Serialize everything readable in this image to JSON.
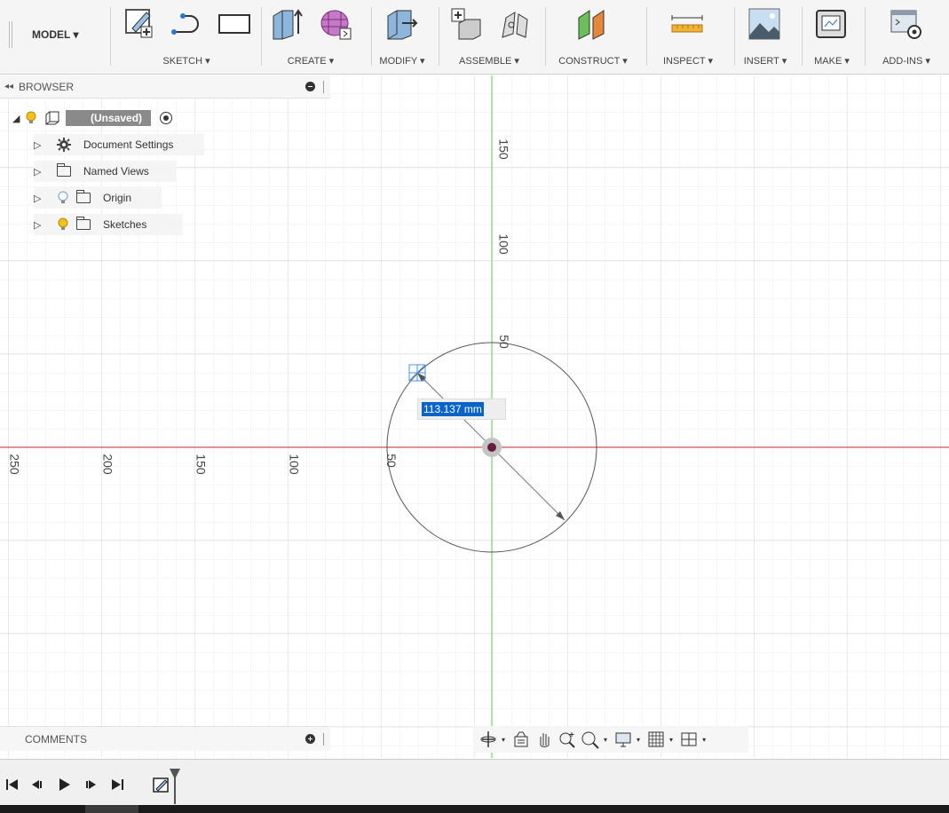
{
  "toolbar": {
    "workspace": "MODEL",
    "groups": [
      {
        "label": "SKETCH"
      },
      {
        "label": "CREATE"
      },
      {
        "label": "MODIFY"
      },
      {
        "label": "ASSEMBLE"
      },
      {
        "label": "CONSTRUCT"
      },
      {
        "label": "INSPECT"
      },
      {
        "label": "INSERT"
      },
      {
        "label": "MAKE"
      },
      {
        "label": "ADD-INS"
      }
    ]
  },
  "browser": {
    "title": "BROWSER",
    "root": "(Unsaved)",
    "items": [
      {
        "label": "Document Settings"
      },
      {
        "label": "Named Views"
      },
      {
        "label": "Origin"
      },
      {
        "label": "Sketches"
      }
    ]
  },
  "comments": {
    "title": "COMMENTS"
  },
  "sketch": {
    "dimension_value": "113.137 mm",
    "vertical_labels": [
      "150",
      "100",
      "50"
    ],
    "horizontal_labels": [
      "250",
      "200",
      "150",
      "100",
      "50"
    ]
  },
  "colors": {
    "x_axis": "#e05a5a",
    "y_axis": "#7ccf7c",
    "selection": "#0a63c9",
    "bulb": "#f2c21b"
  }
}
